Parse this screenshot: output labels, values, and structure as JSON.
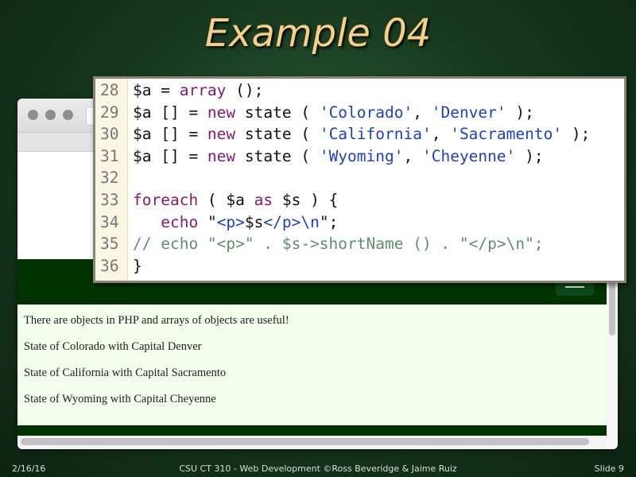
{
  "slide": {
    "title": "Example 04",
    "date": "2/16/16",
    "footer": "CSU CT 310 - Web Development ©Ross Beveridge & Jaime Ruiz",
    "slide_number": "Slide 9"
  },
  "code": {
    "lines": [
      {
        "n": "28",
        "parts": [
          [
            "",
            "$a = "
          ],
          [
            "kw",
            "array"
          ],
          [
            "",
            " ();"
          ]
        ]
      },
      {
        "n": "29",
        "parts": [
          [
            "",
            "$a [] = "
          ],
          [
            "kw",
            "new"
          ],
          [
            "",
            " state ( "
          ],
          [
            "str",
            "'Colorado'"
          ],
          [
            "",
            ", "
          ],
          [
            "str",
            "'Denver'"
          ],
          [
            "",
            " );"
          ]
        ]
      },
      {
        "n": "30",
        "parts": [
          [
            "",
            "$a [] = "
          ],
          [
            "kw",
            "new"
          ],
          [
            "",
            " state ( "
          ],
          [
            "str",
            "'California'"
          ],
          [
            "",
            ", "
          ],
          [
            "str",
            "'Sacramento'"
          ],
          [
            "",
            " );"
          ]
        ]
      },
      {
        "n": "31",
        "parts": [
          [
            "",
            "$a [] = "
          ],
          [
            "kw",
            "new"
          ],
          [
            "",
            " state ( "
          ],
          [
            "str",
            "'Wyoming'"
          ],
          [
            "",
            ", "
          ],
          [
            "str",
            "'Cheyenne'"
          ],
          [
            "",
            " );"
          ]
        ]
      },
      {
        "n": "32",
        "parts": []
      },
      {
        "n": "33",
        "parts": [
          [
            "kw",
            "foreach"
          ],
          [
            "",
            " ( $a "
          ],
          [
            "kw",
            "as"
          ],
          [
            "",
            " $s ) {"
          ]
        ]
      },
      {
        "n": "34",
        "parts": [
          [
            "",
            "   "
          ],
          [
            "kw",
            "echo"
          ],
          [
            "",
            " \""
          ],
          [
            "str",
            "<p>"
          ],
          [
            "",
            "$s"
          ],
          [
            "str",
            "</p>\\n"
          ],
          [
            "",
            "\";"
          ]
        ]
      },
      {
        "n": "35",
        "parts": [
          [
            "cm",
            "// echo \"<p>\" . $s->shortName () . \"</p>\\n\";"
          ]
        ]
      },
      {
        "n": "36",
        "parts": [
          [
            "",
            "}"
          ]
        ]
      }
    ]
  },
  "browser": {
    "content": [
      "There are objects in PHP and arrays of objects are useful!",
      "State of Colorado with Capital Denver",
      "State of California with Capital Sacramento",
      "State of Wyoming with Capital Cheyenne"
    ]
  },
  "icons": {
    "menu": "hamburger-icon",
    "window_controls": "traffic-light-dots"
  }
}
